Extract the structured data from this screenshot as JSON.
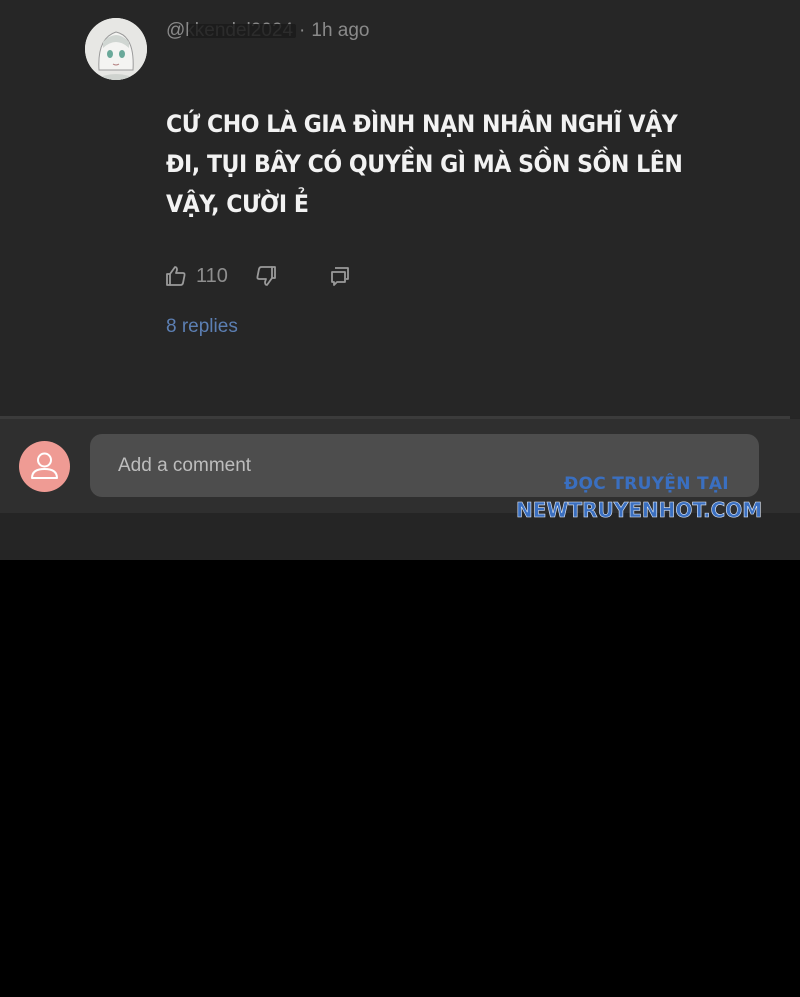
{
  "comment": {
    "author_handle": "@kkendel2024",
    "time": "1h ago",
    "text": "CỨ CHO LÀ GIA ĐÌNH NẠN NHÂN NGHĨ VẬY ĐI, TỤI BÂY CÓ QUYỀN GÌ MÀ SỒN SỒN LÊN VẬY, CƯỜI Ẻ",
    "likes": "110",
    "replies_label": "8 replies"
  },
  "composer": {
    "placeholder": "Add a comment"
  },
  "watermark": {
    "line1": "ĐỌC TRUYỆN TẠI",
    "line2": "NEWTRUYENHOT.COM"
  },
  "icons": {
    "like": "thumbs-up-icon",
    "dislike": "thumbs-down-icon",
    "reply": "reply-icon",
    "user": "person-icon"
  },
  "colors": {
    "background": "#262626",
    "reply_link": "#5c7fb3",
    "avatar_placeholder": "#ef9b94",
    "watermark": "#3a6fc0"
  }
}
